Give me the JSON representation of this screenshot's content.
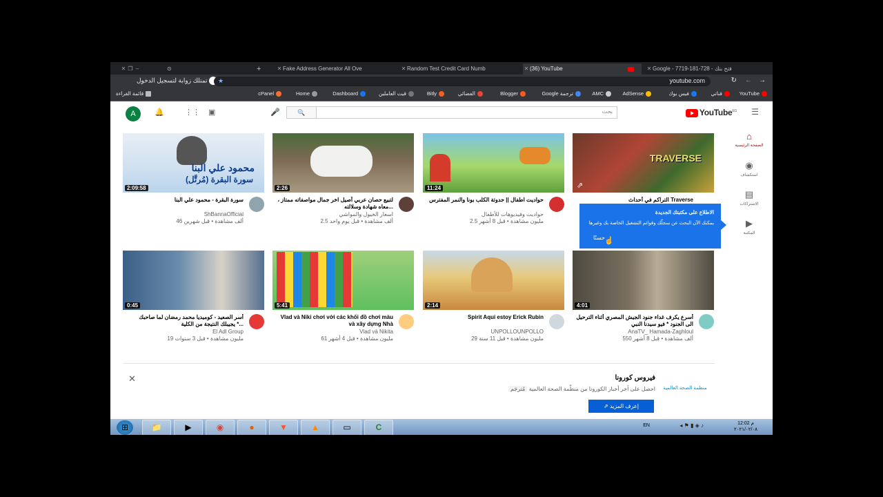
{
  "browser": {
    "tabs": [
      {
        "title": "Fake Address Generator All Ove"
      },
      {
        "title": "Random Test Credit Card Numb"
      },
      {
        "title": "(36) YouTube"
      },
      {
        "title": "Google - 7719-181-728 - فتح بنك"
      }
    ],
    "url": "youtube.com",
    "bookmarks": [
      "YouTube",
      "قناتي",
      "فيس بوك",
      "AdSense",
      "AMC",
      "Google ترجمة",
      "Blogger",
      "الفضائي",
      "Bitly",
      "قيت العاملين",
      "Dashboard",
      "Home",
      "cPanel",
      "قائمة القراءة"
    ],
    "notification_text": "تمتلك زوابة لتسجيل الدخول"
  },
  "youtube": {
    "logo_text": "YouTube",
    "country_code": "EG",
    "search_placeholder": "بحث",
    "avatar_letter": "A",
    "nav": [
      {
        "label": "الصفحة الرئيسية",
        "icon": "home-icon"
      },
      {
        "label": "استكشاف",
        "icon": "explore-icon"
      },
      {
        "label": "الاشتراكات",
        "icon": "subscriptions-icon"
      },
      {
        "label": "المكتبة",
        "icon": "library-icon"
      }
    ],
    "videos": [
      {
        "title": "التراكم في أحداث Traverse",
        "channel": "",
        "stats": "",
        "duration": ""
      },
      {
        "title": "حواديت اطفال || حدوتة الكلب بونا والنمر المفترس",
        "channel": "حواديت وفيديوهات للأطفال",
        "stats": "2.5 مليون مشاهدة • قبل 8 أشهر",
        "duration": "11:24"
      },
      {
        "title": "لتبيع حصان عربي أصيل اخر جمال مواصفاته ممتاز ، معاه شهادة وسلالته...",
        "channel": "اسعار الخيول والمواشي",
        "stats": "2.5 ألف مشاهدة • قبل يوم واحد",
        "duration": "2:26"
      },
      {
        "title": "سورة البقرة - محمود علي البنا",
        "channel": "ShBannaOfficial",
        "stats": "46 ألف مشاهدة • قبل شهرين",
        "duration": "2:09:58",
        "thumb_text_1": "محمود علي البنا",
        "thumb_text_2": "سورة البقرة (مُرتَّل)"
      },
      {
        "title": "أسرع يكرف غداء جنود الجيش المصري أثناء الترحيل الى الجنود * فيو سيدنا النبي",
        "channel": "AnaTV_ Hamada-Zaghloul",
        "stats": "550 ألف مشاهدة • قبل 8 أشهر",
        "duration": "4:01"
      },
      {
        "title": "Spirit Aqui estoy Erick Rubin",
        "channel": "UNPOLLOUNPOLLO",
        "stats": "29 مليون مشاهدة • قبل 11 سنة",
        "duration": "2:14"
      },
      {
        "title": "Vlad và Niki chơi với các khối đồ chơi màu và xây dựng Nhà",
        "channel": "Vlad và Nikita",
        "stats": "61 مليون مشاهدة • قبل 4 أشهر",
        "duration": "5:41"
      },
      {
        "title": "أسر الصعيد - كوميديا محمد رمضان لما صاحبك يجيبلك النتيجة من الكلية *...",
        "channel": "El Adl Group",
        "stats": "19 مليون مشاهدة • قبل 3 سنوات",
        "duration": "0:45"
      }
    ],
    "tooltip": {
      "title": "الاطلاع على مكتبتك الجديدة",
      "body": "يمكنك الآن البحث عن سجلّك وقوائم التشغيل الخاصة بك وغيرها",
      "button": "حسنًا"
    },
    "covid": {
      "title": "فيروس كورونا",
      "description": "احصل على آخر أخبار الكورونا من منظّمة الصحة العالمية",
      "tag": "مُترجَم",
      "button": "إعرف المزيد",
      "logo_text": "منظمة الصحة العالمية"
    }
  },
  "taskbar": {
    "language": "EN",
    "time": "12:02 م",
    "date": "٢٠٢١/٠٢/٠٨"
  }
}
